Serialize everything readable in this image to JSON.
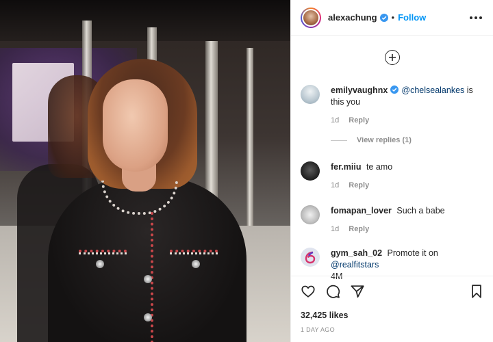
{
  "post": {
    "author": "alexachung",
    "separator": "•",
    "follow_label": "Follow",
    "likes": "32,425 likes",
    "time": "1 DAY AGO"
  },
  "comments": [
    {
      "user": "emilyvaughnx",
      "verified": true,
      "mention": "@chelsealankes",
      "text": "is this you",
      "age": "1d",
      "reply_label": "Reply",
      "avatar_color": "#cfd8de"
    },
    {
      "user": "fer.miiu",
      "text": "te amo",
      "age": "1d",
      "reply_label": "Reply",
      "avatar_color": "#2b2b2b"
    },
    {
      "user": "fomapan_lover",
      "text": "Such a babe",
      "age": "1d",
      "reply_label": "Reply",
      "avatar_color": "#d9d9d9"
    },
    {
      "user": "gym_sah_02",
      "text": "Promote it on",
      "mention": "@realfitstars",
      "extra": "4M",
      "avatar_color": "#e0e4ef"
    }
  ],
  "view_replies": "View replies (1)",
  "icons": {
    "like": "heart-icon",
    "comment": "comment-icon",
    "share": "send-icon",
    "save": "bookmark-icon",
    "load_more": "plus-circle-icon",
    "more": "ellipsis-icon",
    "verified": "verified-badge-icon"
  },
  "colors": {
    "link": "#0095f6",
    "mention": "#00376b",
    "muted": "#8e8e8e",
    "verified": "#3897f0"
  }
}
